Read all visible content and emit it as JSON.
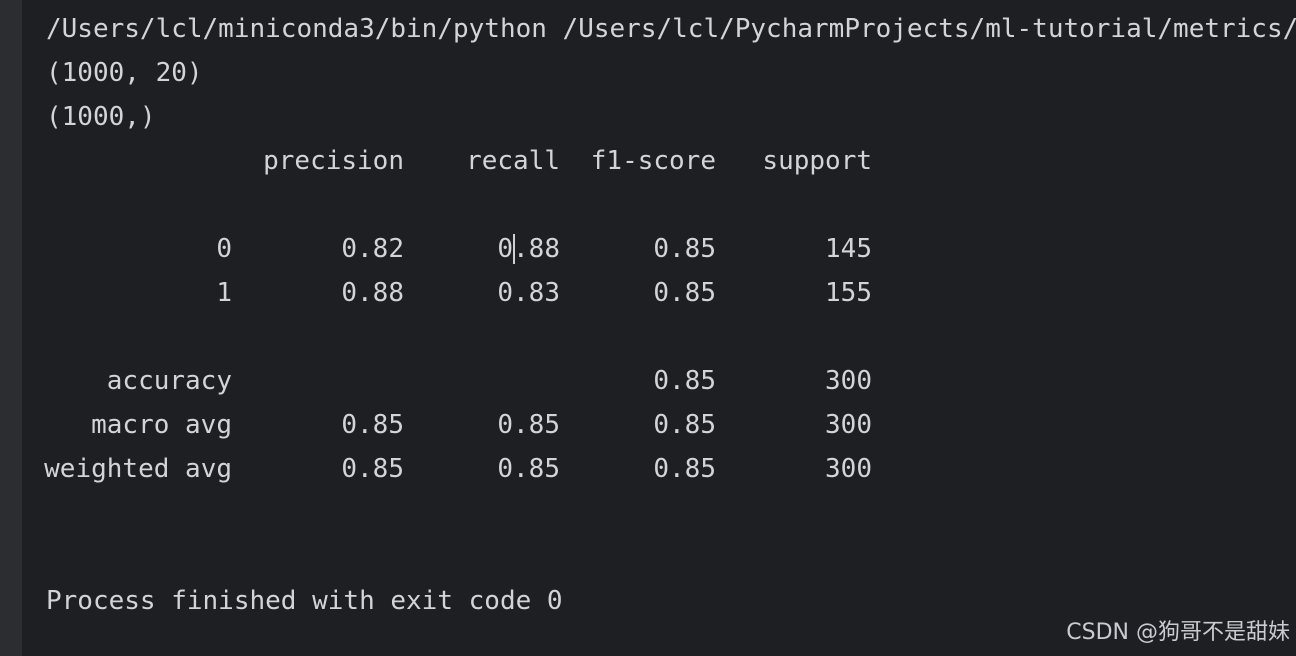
{
  "console": {
    "command": "/Users/lcl/miniconda3/bin/python /Users/lcl/PycharmProjects/ml-tutorial/metrics/",
    "shape_x": "(1000, 20)",
    "shape_y": "(1000,)",
    "report": {
      "headers": [
        "precision",
        "recall",
        "f1-score",
        "support"
      ],
      "rows": [
        {
          "label": "0",
          "precision": "0.82",
          "recall": "0.88",
          "f1": "0.85",
          "support": "145"
        },
        {
          "label": "1",
          "precision": "0.88",
          "recall": "0.83",
          "f1": "0.85",
          "support": "155"
        }
      ],
      "accuracy": {
        "label": "accuracy",
        "f1": "0.85",
        "support": "300"
      },
      "macro": {
        "label": "macro avg",
        "precision": "0.85",
        "recall": "0.85",
        "f1": "0.85",
        "support": "300"
      },
      "weighted": {
        "label": "weighted avg",
        "precision": "0.85",
        "recall": "0.85",
        "f1": "0.85",
        "support": "300"
      }
    },
    "exit_message": "Process finished with exit code 0"
  },
  "watermark": "CSDN @狗哥不是甜妹",
  "colors": {
    "background": "#1e1f22",
    "gutter": "#2b2d30",
    "text": "#d2d4d8"
  }
}
